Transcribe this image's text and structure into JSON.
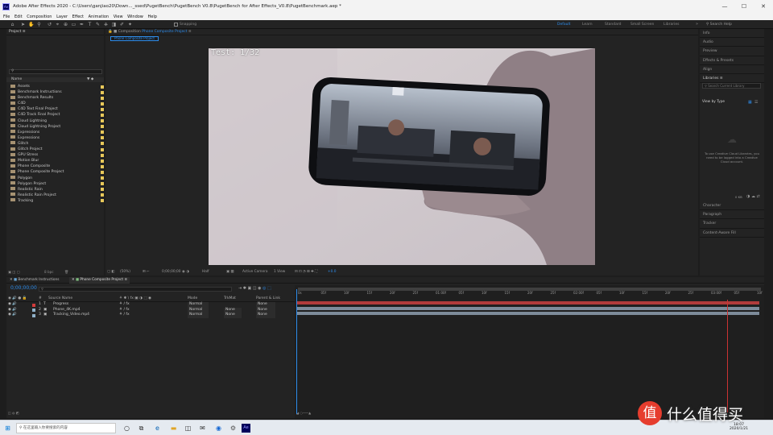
{
  "window": {
    "title": "Adobe After Effects 2020 - C:\\Users\\ganjiao20\\Down..._ssed\\PugetBench\\PugetBench V0.8\\PugetBench for After Effects_V0.8\\PugetBenchmark.aep *",
    "app_icon_text": "Ae",
    "minimize": "—",
    "maximize": "☐",
    "close": "✕"
  },
  "menu": [
    "File",
    "Edit",
    "Composition",
    "Layer",
    "Effect",
    "Animation",
    "View",
    "Window",
    "Help"
  ],
  "toolbar": {
    "snapping_label": "Snapping",
    "workspaces": [
      "Default",
      "Learn",
      "Standard",
      "Small Screen",
      "Libraries"
    ],
    "search_placeholder": "Search Help"
  },
  "project_panel": {
    "tab_label": "Project",
    "search_placeholder": "",
    "column_name": "Name",
    "items": [
      {
        "name": "Assets",
        "label_color": "#e8c85a"
      },
      {
        "name": "Benchmark Instructions",
        "label_color": "#e8c85a"
      },
      {
        "name": "Benchmark Results",
        "label_color": "#e8c85a"
      },
      {
        "name": "C4D",
        "label_color": "#e8c85a"
      },
      {
        "name": "C4D Text Final Project",
        "label_color": "#e8c85a"
      },
      {
        "name": "C4D Track Final Project",
        "label_color": "#e8c85a"
      },
      {
        "name": "Cloud Lightning",
        "label_color": "#e8c85a"
      },
      {
        "name": "Cloud Lightning Project",
        "label_color": "#e8c85a"
      },
      {
        "name": "Expressions",
        "label_color": "#e8c85a"
      },
      {
        "name": "Expressions",
        "label_color": "#e8c85a"
      },
      {
        "name": "Glitch",
        "label_color": "#e8c85a"
      },
      {
        "name": "Glitch Project",
        "label_color": "#e8c85a"
      },
      {
        "name": "GPU Stress",
        "label_color": "#e8c85a"
      },
      {
        "name": "Motion Blur",
        "label_color": "#e8c85a"
      },
      {
        "name": "Phone Composite",
        "label_color": "#e8c85a"
      },
      {
        "name": "Phone Composite Project",
        "label_color": "#e8c85a"
      },
      {
        "name": "Polygon",
        "label_color": "#e8c85a"
      },
      {
        "name": "Polygon Project",
        "label_color": "#e8c85a"
      },
      {
        "name": "Realistic Rain",
        "label_color": "#e8c85a"
      },
      {
        "name": "Realistic Rain Project",
        "label_color": "#e8c85a"
      },
      {
        "name": "Tracking",
        "label_color": "#e8c85a"
      }
    ],
    "bpc": "8 bpc"
  },
  "composition_panel": {
    "tab_label": "Composition",
    "tab_comp_name": "Phone Composite Project",
    "breadcrumb": "Phone Composite Project",
    "overlay_text": "Test: 1/32",
    "zoom": "(50%)",
    "timecode": "0;00;00;00",
    "resolution": "Half",
    "camera": "Active Camera",
    "views": "1 View",
    "offset": "+0.0"
  },
  "right_panel": {
    "items_top": [
      "Info",
      "Audio",
      "Preview",
      "Effects & Presets",
      "Align"
    ],
    "libraries_label": "Libraries",
    "libraries_search": "Search Current Library",
    "view_by": "View by Type",
    "cc_message": "To use Creative Cloud Libraries, you need to be logged into a Creative Cloud account.",
    "kb": "0 KB",
    "items_bottom": [
      "Character",
      "Paragraph",
      "Tracker",
      "Content-Aware Fill"
    ]
  },
  "timeline": {
    "tabs": [
      "Benchmark Instructions",
      "Phone Composite Project"
    ],
    "timecode": "0;00;00;00",
    "search_placeholder": "",
    "columns": {
      "num": "#",
      "source_name": "Source Name",
      "mode": "Mode",
      "trkmat": "TrkMat",
      "parent": "Parent & Link"
    },
    "layers": [
      {
        "num": "1",
        "type": "T",
        "name": "Progress",
        "label_color": "#d23b3b",
        "mode": "Normal",
        "trkmat": "",
        "parent": "None"
      },
      {
        "num": "2",
        "type": "▣",
        "name": "Phone_4K.mp4",
        "label_color": "#8fb0c8",
        "mode": "Normal",
        "trkmat": "None",
        "parent": "None"
      },
      {
        "num": "3",
        "type": "▣",
        "name": "Tracking_Video.mp4",
        "label_color": "#8fb0c8",
        "mode": "Normal",
        "trkmat": "None",
        "parent": "None"
      }
    ],
    "ruler_ticks": [
      "0s",
      "05f",
      "10f",
      "15f",
      "20f",
      "25f",
      "01:00f",
      "05f",
      "10f",
      "15f",
      "20f",
      "25f",
      "02:00f",
      "05f",
      "10f",
      "15f",
      "20f",
      "25f",
      "03:00f",
      "05f",
      "10f"
    ],
    "toggle_label": "Toggle Switches / Modes"
  },
  "taskbar": {
    "search_placeholder": "在这里输入你要搜索的内容",
    "time": "18:07",
    "date": "2020/1/21",
    "watermark_text": "什么值得买",
    "watermark_badge": "值"
  }
}
